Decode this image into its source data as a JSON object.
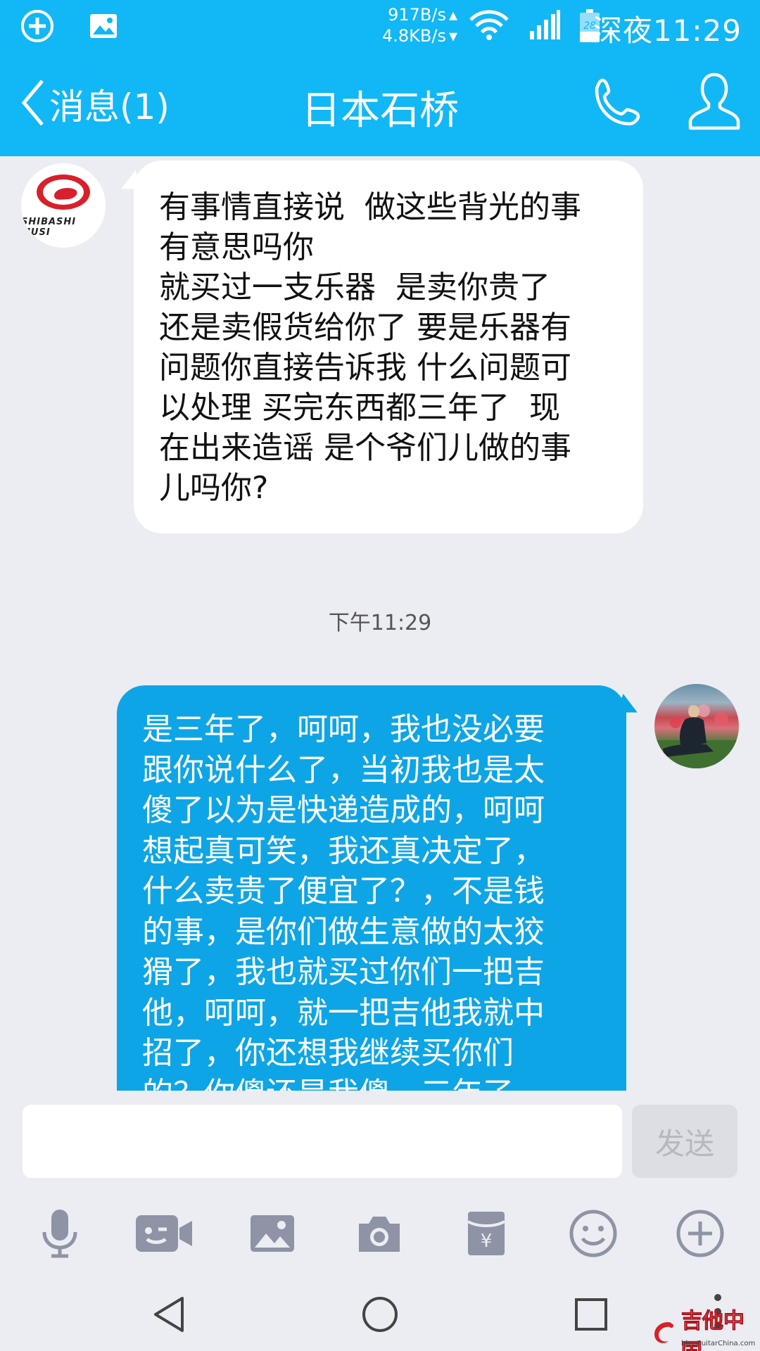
{
  "status_bar": {
    "net_down": "917B/s",
    "net_up": "4.8KB/s",
    "battery_level": "28",
    "time": "深夜11:29",
    "icons": [
      "add-circle-icon",
      "image-icon",
      "wifi-icon",
      "signal-icon",
      "battery-icon"
    ]
  },
  "header": {
    "back_label": "消息(1)",
    "title": "日本石桥",
    "icons": [
      "phone-icon",
      "profile-icon"
    ]
  },
  "avatar_left": {
    "logo_text": "SHIBASHI MUSI"
  },
  "messages": [
    {
      "direction": "incoming",
      "text": "有事情直接说  做这些背光的事\n有意思吗你\n就买过一支乐器  是卖你贵了\n还是卖假货给你了 要是乐器有\n问题你直接告诉我 什么问题可\n以处理 买完东西都三年了  现\n在出来造谣 是个爷们儿做的事\n儿吗你?"
    },
    {
      "direction": "outgoing",
      "text": "是三年了，呵呵，我也没必要\n跟你说什么了，当初我也是太\n傻了以为是快递造成的，呵呵\n想起真可笑，我还真决定了，\n什么卖贵了便宜了？，不是钱\n的事，是你们做生意做的太狡\n猾了，我也就买过你们一把吉\n他，呵呵，就一把吉他我就中\n招了，你还想我继续买你们\n的？你傻还是我傻，三年了"
    }
  ],
  "timestamp": "下午11:29",
  "input": {
    "placeholder": "",
    "send_label": "发送"
  },
  "toolbar": [
    "microphone-icon",
    "video-call-icon",
    "photo-icon",
    "camera-icon",
    "red-packet-icon",
    "emoji-icon",
    "plus-icon"
  ],
  "navbar": [
    "back-icon",
    "home-icon",
    "recents-icon"
  ],
  "watermark": {
    "text": "吉他中国",
    "sub": "bbs.GuitarChina.com"
  },
  "colors": {
    "brand_blue": "#12b7f5",
    "outgoing_bubble": "#0ea5e6",
    "background": "#ebedf2"
  }
}
